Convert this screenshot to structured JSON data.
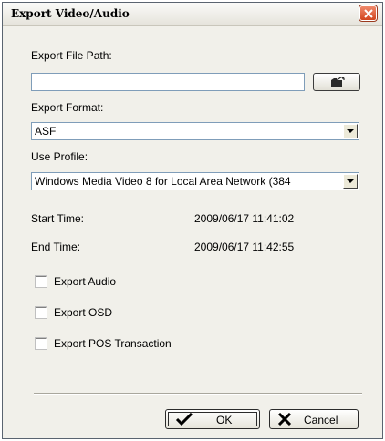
{
  "window": {
    "title": "Export Video/Audio"
  },
  "file_path": {
    "label": "Export File Path:",
    "value": ""
  },
  "format": {
    "label": "Export Format:",
    "selected": "ASF"
  },
  "profile": {
    "label": "Use Profile:",
    "selected": "Windows Media Video 8 for Local Area Network (384"
  },
  "times": {
    "start_label": "Start Time:",
    "start_value": "2009/06/17 11:41:02",
    "end_label": "End Time:",
    "end_value": "2009/06/17 11:42:55"
  },
  "options": [
    {
      "label": "Export Audio",
      "checked": false
    },
    {
      "label": "Export OSD",
      "checked": false
    },
    {
      "label": "Export POS Transaction",
      "checked": false
    }
  ],
  "buttons": {
    "ok_label": "OK",
    "cancel_label": "Cancel"
  },
  "icons": {
    "browse": "folder-open-icon",
    "ok": "checkmark-icon",
    "cancel": "x-icon",
    "close": "close-icon"
  }
}
